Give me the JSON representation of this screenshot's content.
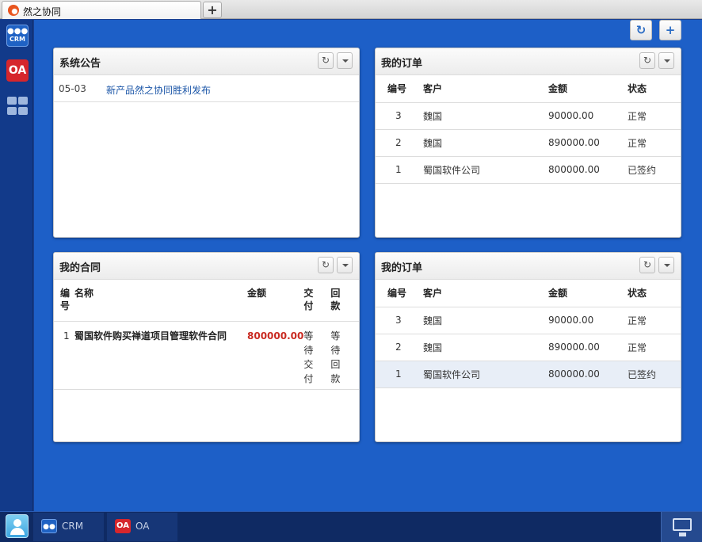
{
  "browser": {
    "tab_title": "然之协同",
    "new_tab_label": "+"
  },
  "rail": {
    "crm_label": "CRM",
    "oa_label": "OA"
  },
  "toolbar": {
    "refresh_icon": "refresh-icon",
    "add_label": "+"
  },
  "announcements": {
    "title": "系统公告",
    "items": [
      {
        "date": "05-03",
        "title": "新产品然之协同胜利发布"
      }
    ]
  },
  "orders_top": {
    "title": "我的订单",
    "columns": [
      "编号",
      "客户",
      "金额",
      "状态"
    ],
    "rows": [
      {
        "id": "3",
        "customer": "魏国",
        "amount": "90000.00",
        "status": "正常"
      },
      {
        "id": "2",
        "customer": "魏国",
        "amount": "890000.00",
        "status": "正常"
      },
      {
        "id": "1",
        "customer": "蜀国软件公司",
        "amount": "800000.00",
        "status": "已签约"
      }
    ]
  },
  "contracts": {
    "title": "我的合同",
    "columns": [
      "编号",
      "名称",
      "金额",
      "交付",
      "回款"
    ],
    "rows": [
      {
        "id": "1",
        "name": "蜀国软件购买禅道项目管理软件合同",
        "amount": "800000.00",
        "delivery": "等待交付",
        "payment": "等待回款"
      }
    ]
  },
  "orders_bottom": {
    "title": "我的订单",
    "columns": [
      "编号",
      "客户",
      "金额",
      "状态"
    ],
    "rows": [
      {
        "id": "3",
        "customer": "魏国",
        "amount": "90000.00",
        "status": "正常"
      },
      {
        "id": "2",
        "customer": "魏国",
        "amount": "890000.00",
        "status": "正常"
      },
      {
        "id": "1",
        "customer": "蜀国软件公司",
        "amount": "800000.00",
        "status": "已签约"
      }
    ]
  },
  "taskbar": {
    "crm_label": "CRM",
    "oa_label": "OA"
  },
  "colors": {
    "desktop": "#1d5fc7",
    "accent_red": "#c92a21",
    "link": "#1d57a8"
  }
}
